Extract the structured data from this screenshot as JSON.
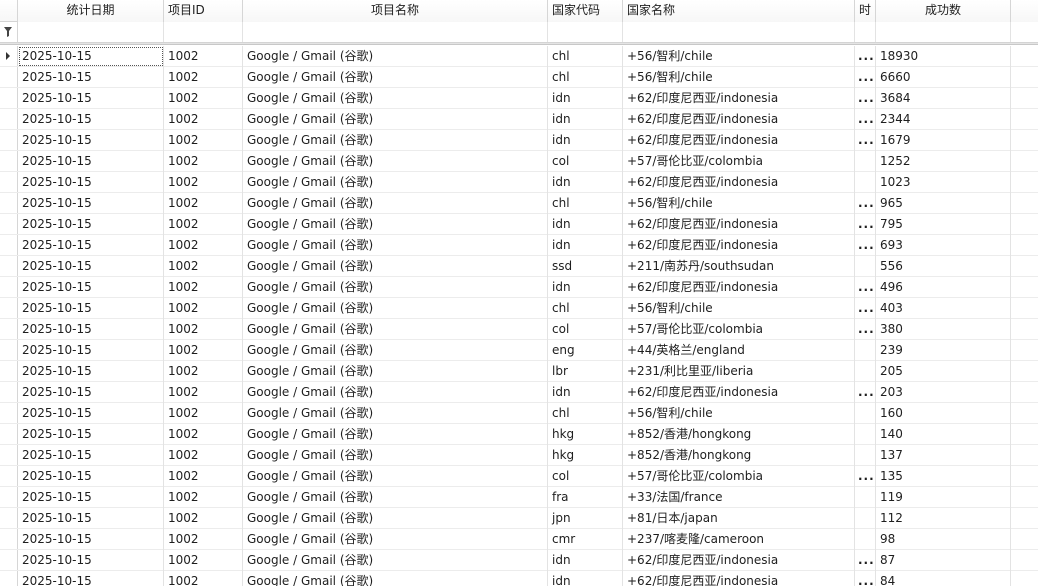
{
  "columns": [
    "统计日期",
    "项目ID",
    "项目名称",
    "国家代码",
    "国家名称",
    "时",
    "成功数"
  ],
  "rows": [
    {
      "date": "2025-10-15",
      "pid": "1002",
      "pname": "Google / Gmail (谷歌)",
      "code": "chl",
      "country": "+56/智利/chile",
      "ell": "...",
      "count": "18930"
    },
    {
      "date": "2025-10-15",
      "pid": "1002",
      "pname": "Google / Gmail (谷歌)",
      "code": "chl",
      "country": "+56/智利/chile",
      "ell": "...",
      "count": "6660"
    },
    {
      "date": "2025-10-15",
      "pid": "1002",
      "pname": "Google / Gmail (谷歌)",
      "code": "idn",
      "country": "+62/印度尼西亚/indonesia",
      "ell": "...",
      "count": "3684"
    },
    {
      "date": "2025-10-15",
      "pid": "1002",
      "pname": "Google / Gmail (谷歌)",
      "code": "idn",
      "country": "+62/印度尼西亚/indonesia",
      "ell": "...",
      "count": "2344"
    },
    {
      "date": "2025-10-15",
      "pid": "1002",
      "pname": "Google / Gmail (谷歌)",
      "code": "idn",
      "country": "+62/印度尼西亚/indonesia",
      "ell": "...",
      "count": "1679"
    },
    {
      "date": "2025-10-15",
      "pid": "1002",
      "pname": "Google / Gmail (谷歌)",
      "code": "col",
      "country": "+57/哥伦比亚/colombia",
      "ell": "",
      "count": "1252"
    },
    {
      "date": "2025-10-15",
      "pid": "1002",
      "pname": "Google / Gmail (谷歌)",
      "code": "idn",
      "country": "+62/印度尼西亚/indonesia",
      "ell": "",
      "count": "1023"
    },
    {
      "date": "2025-10-15",
      "pid": "1002",
      "pname": "Google / Gmail (谷歌)",
      "code": "chl",
      "country": "+56/智利/chile",
      "ell": "...",
      "count": "965"
    },
    {
      "date": "2025-10-15",
      "pid": "1002",
      "pname": "Google / Gmail (谷歌)",
      "code": "idn",
      "country": "+62/印度尼西亚/indonesia",
      "ell": "...",
      "count": "795"
    },
    {
      "date": "2025-10-15",
      "pid": "1002",
      "pname": "Google / Gmail (谷歌)",
      "code": "idn",
      "country": "+62/印度尼西亚/indonesia",
      "ell": "...",
      "count": "693"
    },
    {
      "date": "2025-10-15",
      "pid": "1002",
      "pname": "Google / Gmail (谷歌)",
      "code": "ssd",
      "country": "+211/南苏丹/southsudan",
      "ell": "",
      "count": "556"
    },
    {
      "date": "2025-10-15",
      "pid": "1002",
      "pname": "Google / Gmail (谷歌)",
      "code": "idn",
      "country": "+62/印度尼西亚/indonesia",
      "ell": "...",
      "count": "496"
    },
    {
      "date": "2025-10-15",
      "pid": "1002",
      "pname": "Google / Gmail (谷歌)",
      "code": "chl",
      "country": "+56/智利/chile",
      "ell": "...",
      "count": "403"
    },
    {
      "date": "2025-10-15",
      "pid": "1002",
      "pname": "Google / Gmail (谷歌)",
      "code": "col",
      "country": "+57/哥伦比亚/colombia",
      "ell": "...",
      "count": "380"
    },
    {
      "date": "2025-10-15",
      "pid": "1002",
      "pname": "Google / Gmail (谷歌)",
      "code": "eng",
      "country": "+44/英格兰/england",
      "ell": "",
      "count": "239"
    },
    {
      "date": "2025-10-15",
      "pid": "1002",
      "pname": "Google / Gmail (谷歌)",
      "code": "lbr",
      "country": "+231/利比里亚/liberia",
      "ell": "",
      "count": "205"
    },
    {
      "date": "2025-10-15",
      "pid": "1002",
      "pname": "Google / Gmail (谷歌)",
      "code": "idn",
      "country": "+62/印度尼西亚/indonesia",
      "ell": "...",
      "count": "203"
    },
    {
      "date": "2025-10-15",
      "pid": "1002",
      "pname": "Google / Gmail (谷歌)",
      "code": "chl",
      "country": "+56/智利/chile",
      "ell": "",
      "count": "160"
    },
    {
      "date": "2025-10-15",
      "pid": "1002",
      "pname": "Google / Gmail (谷歌)",
      "code": "hkg",
      "country": "+852/香港/hongkong",
      "ell": "",
      "count": "140"
    },
    {
      "date": "2025-10-15",
      "pid": "1002",
      "pname": "Google / Gmail (谷歌)",
      "code": "hkg",
      "country": "+852/香港/hongkong",
      "ell": "",
      "count": "137"
    },
    {
      "date": "2025-10-15",
      "pid": "1002",
      "pname": "Google / Gmail (谷歌)",
      "code": "col",
      "country": "+57/哥伦比亚/colombia",
      "ell": "...",
      "count": "135"
    },
    {
      "date": "2025-10-15",
      "pid": "1002",
      "pname": "Google / Gmail (谷歌)",
      "code": "fra",
      "country": "+33/法国/france",
      "ell": "",
      "count": "119"
    },
    {
      "date": "2025-10-15",
      "pid": "1002",
      "pname": "Google / Gmail (谷歌)",
      "code": "jpn",
      "country": "+81/日本/japan",
      "ell": "",
      "count": "112"
    },
    {
      "date": "2025-10-15",
      "pid": "1002",
      "pname": "Google / Gmail (谷歌)",
      "code": "cmr",
      "country": "+237/喀麦隆/cameroon",
      "ell": "",
      "count": "98"
    },
    {
      "date": "2025-10-15",
      "pid": "1002",
      "pname": "Google / Gmail (谷歌)",
      "code": "idn",
      "country": "+62/印度尼西亚/indonesia",
      "ell": "...",
      "count": "87"
    },
    {
      "date": "2025-10-15",
      "pid": "1002",
      "pname": "Google / Gmail (谷歌)",
      "code": "idn",
      "country": "+62/印度尼西亚/indonesia",
      "ell": "...",
      "count": "84"
    }
  ]
}
